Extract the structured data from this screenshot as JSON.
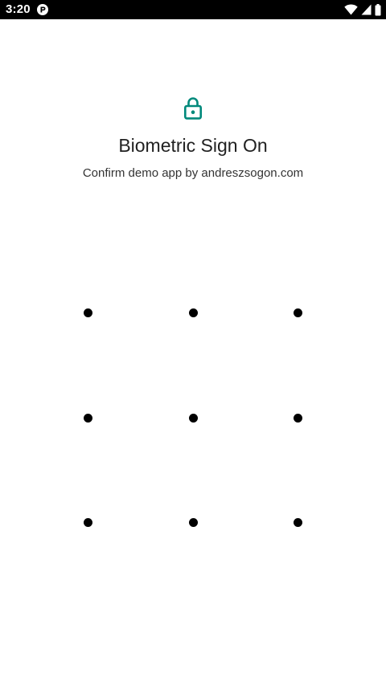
{
  "status_bar": {
    "time": "3:20",
    "notification_icon": "app-notification-icon",
    "icons": [
      "wifi-icon",
      "cellular-signal-icon",
      "battery-icon"
    ]
  },
  "header": {
    "icon": "lock-icon",
    "accent_color": "#00897b",
    "title": "Biometric Sign On",
    "subtitle": "Confirm demo app by andreszsogon.com"
  },
  "pattern": {
    "rows": 3,
    "cols": 3,
    "dot_color": "#000000",
    "dots": [
      "1",
      "2",
      "3",
      "4",
      "5",
      "6",
      "7",
      "8",
      "9"
    ]
  }
}
